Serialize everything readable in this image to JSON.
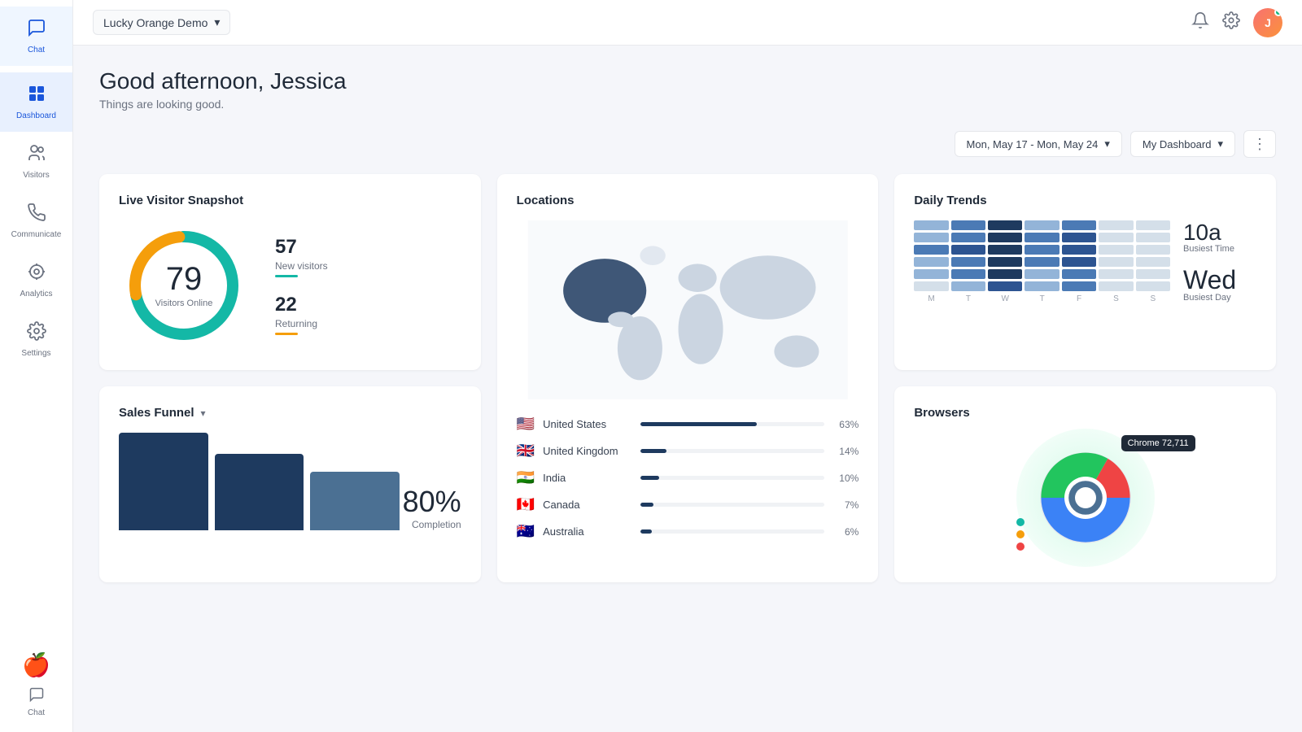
{
  "sidebar": {
    "items": [
      {
        "id": "chat",
        "label": "Chat",
        "icon": "💬",
        "active": false
      },
      {
        "id": "dashboard",
        "label": "Dashboard",
        "icon": "📊",
        "active": true
      },
      {
        "id": "visitors",
        "label": "Visitors",
        "icon": "👥",
        "active": false
      },
      {
        "id": "communicate",
        "label": "Communicate",
        "icon": "📣",
        "active": false
      },
      {
        "id": "analytics",
        "label": "Analytics",
        "icon": "🔗",
        "active": false
      },
      {
        "id": "settings",
        "label": "Settings",
        "icon": "⚙️",
        "active": false
      }
    ],
    "bottom_item": {
      "id": "chat-bottom",
      "label": "Chat",
      "icon": "💬"
    }
  },
  "header": {
    "site_name": "Lucky Orange Demo",
    "date_range": "Mon, May 17 - Mon, May 24",
    "dashboard_name": "My Dashboard"
  },
  "greeting": {
    "title": "Good afternoon, Jessica",
    "subtitle": "Things are looking good."
  },
  "live_snapshot": {
    "title": "Live Visitor Snapshot",
    "total": "79",
    "total_label": "Visitors Online",
    "new_count": "57",
    "new_label": "New visitors",
    "returning_count": "22",
    "returning_label": "Returning"
  },
  "locations": {
    "title": "Locations",
    "countries": [
      {
        "flag": "🇺🇸",
        "name": "United States",
        "pct": 63,
        "pct_label": "63%"
      },
      {
        "flag": "🇬🇧",
        "name": "United Kingdom",
        "pct": 14,
        "pct_label": "14%"
      },
      {
        "flag": "🇮🇳",
        "name": "India",
        "pct": 10,
        "pct_label": "10%"
      },
      {
        "flag": "🇨🇦",
        "name": "Canada",
        "pct": 7,
        "pct_label": "7%"
      },
      {
        "flag": "🇦🇺",
        "name": "Australia",
        "pct": 6,
        "pct_label": "6%"
      }
    ]
  },
  "daily_trends": {
    "title": "Daily Trends",
    "busiest_time": "10a",
    "busiest_time_label": "Busiest Time",
    "busiest_day": "Wed",
    "busiest_day_label": "Busiest Day",
    "days": [
      "M",
      "T",
      "W",
      "T",
      "F",
      "S",
      "S"
    ]
  },
  "sales_funnel": {
    "title": "Sales Funnel",
    "completion_pct": "80%",
    "completion_label": "Completion",
    "bars": [
      100,
      78,
      60
    ]
  },
  "browsers": {
    "title": "Browsers",
    "chrome_label": "Chrome",
    "chrome_count": "72,711"
  }
}
